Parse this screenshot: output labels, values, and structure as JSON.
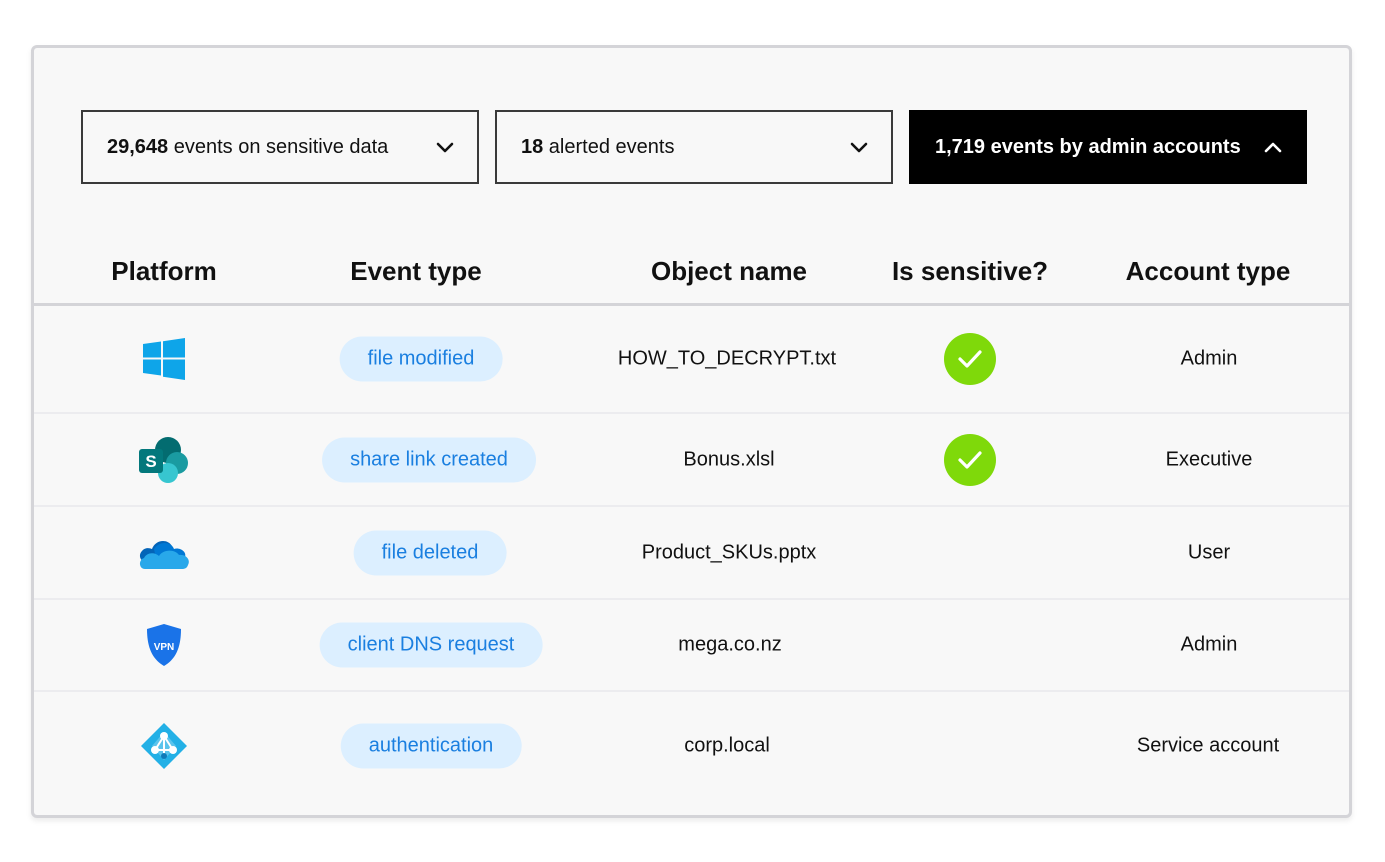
{
  "filters": [
    {
      "count": "29,648",
      "label": " events on sensitive data",
      "expanded": false
    },
    {
      "count": "18",
      "label": " alerted events",
      "expanded": false
    },
    {
      "count": "1,719",
      "label": " events by admin accounts",
      "expanded": true
    }
  ],
  "columns": [
    "Platform",
    "Event type",
    "Object name",
    "Is sensitive?",
    "Account type"
  ],
  "rows": [
    {
      "platform": "windows-icon",
      "event_type": "file modified",
      "object_name": "HOW_TO_DECRYPT.txt",
      "is_sensitive": true,
      "account_type": "Admin"
    },
    {
      "platform": "sharepoint-icon",
      "event_type": "share link created",
      "object_name": "Bonus.xlsl",
      "is_sensitive": true,
      "account_type": "Executive"
    },
    {
      "platform": "onedrive-icon",
      "event_type": "file deleted",
      "object_name": "Product_SKUs.pptx",
      "is_sensitive": false,
      "account_type": "User"
    },
    {
      "platform": "vpn-shield-icon",
      "vpn_label": "VPN",
      "event_type": "client DNS request",
      "object_name": "mega.co.nz",
      "is_sensitive": false,
      "account_type": "Admin"
    },
    {
      "platform": "azure-ad-icon",
      "event_type": "authentication",
      "object_name": "corp.local",
      "is_sensitive": false,
      "account_type": "Service account"
    }
  ],
  "colors": {
    "pill_bg": "#dcefff",
    "pill_text": "#1a7fe0",
    "check": "#7fd90a",
    "active_filter_bg": "#000000",
    "panel_bg": "#f8f8f8"
  }
}
